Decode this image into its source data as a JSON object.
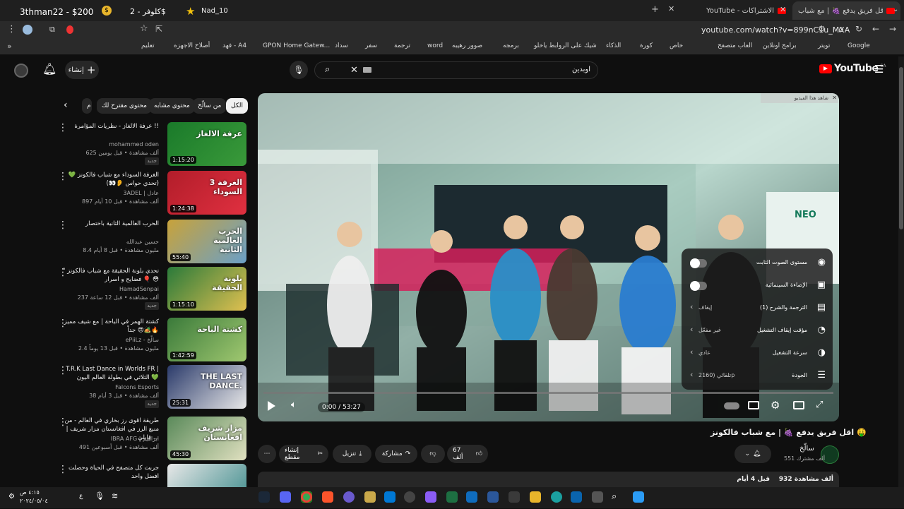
{
  "browser": {
    "tab_ext_title": "3thman22 - $200",
    "tab_ext_coin": "$",
    "tab_ext_user": "كلوفر - 2$",
    "tab_ext_nad": "Nad_10",
    "tab_subs": "YouTube - الاشتراكات",
    "tab_active": "اقل فريق يدفع 🍇 | مع شباب",
    "url": "youtube.com/watch?v=899nC1u_MXA",
    "bookmarks": [
      "Google",
      "تويتر",
      "برامج اونلاين",
      "العاب متصفح",
      "خاص",
      "كورة",
      "الذكاء",
      "شيك على الروابط ياخلو",
      "برمجه",
      "صوور رهيبه",
      "word",
      "ترجمة",
      "سفر",
      "سداد",
      "GPON Home Gatew...",
      "فهد - A4",
      "أصلاح الاجهزه",
      "تعليم"
    ]
  },
  "header": {
    "logo": "YouTube",
    "logo_region": "SA",
    "search_value": "اوبدين",
    "create_label": "إنشاء"
  },
  "chips": [
    "الكل",
    "من سالّخ",
    "محتوى مشابه",
    "محتوى مقترح لك",
    "م"
  ],
  "sidebar": {
    "items": [
      {
        "title": "عرفة الالغاز - نظريات المؤامرة !!",
        "channel": "mohammed oden",
        "meta": "625 ألف مشاهدة • قبل يومين",
        "badge": "جديد",
        "duration": "1:15:20",
        "thumb_text": "عرفة الالغاز"
      },
      {
        "title": "الغرفة السوداء مع شباب فالكونز 💚 (تحدي حواس 👂👀)",
        "channel": "3ADEL | عادل",
        "meta": "897 ألف مشاهدة • قبل 10 أيام",
        "badge": "",
        "duration": "1:24:38",
        "thumb_text": "الغرفة 3 السوداء"
      },
      {
        "title": "الحرب العالمية الثانية باختصار",
        "channel": "حسين عبدالله",
        "meta": "8.4 مليون مشاهدة • قبل 8 أيام",
        "badge": "",
        "duration": "55:40",
        "thumb_text": "الحرب العالمية الثانية"
      },
      {
        "title": "\" تحدي بلونة الحقيقة مع شباب فالكونز 🎈 فضايح و اسرار 😳",
        "channel": "HamadSenpai",
        "meta": "237 ألف مشاهدة • قبل 12 ساعة",
        "badge": "جديد",
        "duration": "1:15:10",
        "thumb_text": "بلونة الحقيقة"
      },
      {
        "title": "كشتة الهمر في الباحة | مع شيف مميز جداً 😍🏕️🔥",
        "channel": "ePiiLz - سالّخ",
        "meta": "2.4 مليون مشاهدة • قبل 13 يوماً",
        "badge": "",
        "duration": "1:42:59",
        "thumb_text": "كشتة الباحة"
      },
      {
        "title": "T.R.K Last Dance in Worlds FR | الثلاثي في بطولة العالم اليون 💚",
        "channel": "Falcons Esports",
        "meta": "38 ألف مشاهدة • قبل 3 أيام",
        "badge": "جديد",
        "duration": "25:31",
        "thumb_text": "THE LAST DANCE."
      },
      {
        "title": "طريقة اقوى رز بخاري في العالم - من منبع الرز في افغانستان مزار شريف | قابلي ...",
        "channel": "IBRA AFG | ابراهيم",
        "meta": "491 ألف مشاهدة • قبل أسبوعين",
        "badge": "",
        "duration": "45:30",
        "thumb_text": "مزار شريف افغانستان"
      },
      {
        "title": "جربت كل متصفح في الحياة وحصلت افضل واحد",
        "channel": "",
        "meta": "",
        "badge": "",
        "duration": "",
        "thumb_text": ""
      }
    ]
  },
  "player": {
    "time": "0:00 / 53:27",
    "promo_text": "شاهد هذا الفيديو",
    "wall_brand": "NEO",
    "menu": [
      {
        "label": "مستوى الصوت الثابت",
        "value": "",
        "toggle": true
      },
      {
        "label": "الإضاءة السينمائية",
        "value": "",
        "toggle": true
      },
      {
        "label": "الترجمة والشرح (1)",
        "value": "إيقاف",
        "toggle": false
      },
      {
        "label": "مؤقت إيقاف التشغيل",
        "value": "غير مفعّل",
        "toggle": false
      },
      {
        "label": "سرعة التشغيل",
        "value": "عادي",
        "toggle": false
      },
      {
        "label": "الجودة",
        "value": "تلقائي (2160p",
        "toggle": false
      }
    ]
  },
  "video": {
    "title": "اقل فريق يدفع 🍇 | مع شباب فالكونز 🤑",
    "channel": "سالّخ",
    "subs": "551 ألف مشترك",
    "likes": "67 ألف",
    "share": "مشاركة",
    "download": "تنزيل",
    "clip": "إنشاء مقطع",
    "views": "932 ألف مشاهدة",
    "date": "قبل 4 أيام"
  },
  "taskbar": {
    "time": "٤:١٥ ص",
    "date": "٢٠٢٤/٠٥/٠٤",
    "lang": "ع"
  }
}
